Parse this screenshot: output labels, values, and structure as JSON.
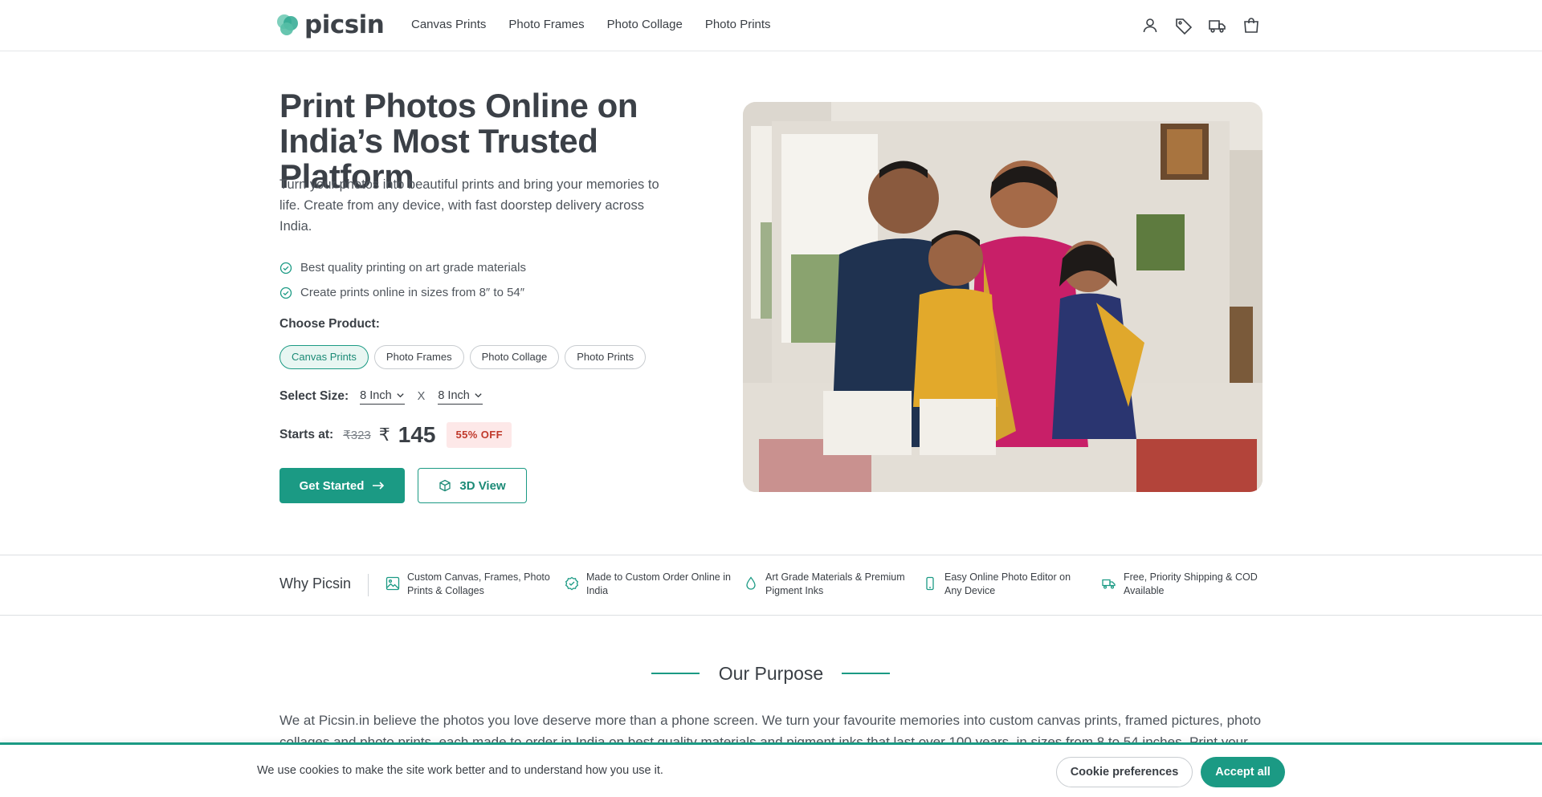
{
  "brand": {
    "name": "picsin",
    "accent": "#1b9a84"
  },
  "nav": {
    "items": [
      "Canvas Prints",
      "Photo Frames",
      "Photo Collage",
      "Photo Prints"
    ],
    "icons": [
      "user-icon",
      "tag-icon",
      "truck-icon",
      "cart-icon"
    ]
  },
  "hero": {
    "title": "Print Photos Online on India’s Most Trusted Platform",
    "subtitle": "Turn your photos into beautiful prints and bring your memories to life. Create from any device, with fast doorstep delivery across India.",
    "bullets": [
      "Best quality printing on art grade materials",
      "Create prints online in sizes from 8″ to 54″"
    ],
    "choose_label": "Choose Product:",
    "products": [
      "Canvas Prints",
      "Photo Frames",
      "Photo Collage",
      "Photo Prints"
    ],
    "selected_product": "Canvas Prints",
    "size_label": "Select Size:",
    "width_value": "8 Inch",
    "size_separator": "X",
    "height_value": "8 Inch",
    "price_label": "Starts at:",
    "price_old": "₹323",
    "currency": "₹",
    "price_new": "145",
    "discount": "55% OFF",
    "cta_primary": "Get Started",
    "cta_secondary": "3D View"
  },
  "why": {
    "title": "Why Picsin",
    "items": [
      {
        "icon": "image-icon",
        "text": "Custom Canvas, Frames, Photo Prints & Collages"
      },
      {
        "icon": "badge-check-icon",
        "text": "Made to Custom Order Online in India"
      },
      {
        "icon": "drop-icon",
        "text": "Art Grade Materials & Premium Pigment Inks"
      },
      {
        "icon": "phone-icon",
        "text": "Easy Online Photo Editor on Any Device"
      },
      {
        "icon": "truck-icon",
        "text": "Free, Priority Shipping & COD Available"
      }
    ]
  },
  "purpose": {
    "title": "Our Purpose",
    "text": "We at Picsin.in believe the photos you love deserve more than a phone screen. We turn your favourite memories into custom canvas prints, framed pictures, photo collages and photo prints, each made to order in India on best quality materials and pigment inks that last over 100 years, in sizes from 8 to 54 inches. Print your photos online from"
  },
  "cookie": {
    "message": "We use cookies to make the site work better and to understand how you use it.",
    "preferences": "Cookie preferences",
    "accept": "Accept all"
  }
}
